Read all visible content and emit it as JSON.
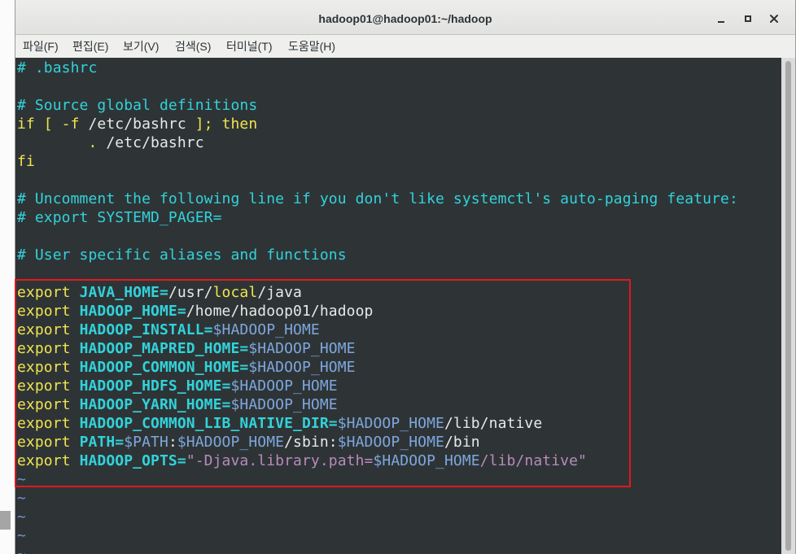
{
  "window": {
    "title": "hadoop01@hadoop01:~/hadoop",
    "controls": [
      "minimize-icon",
      "maximize-icon",
      "close-icon"
    ]
  },
  "menu": {
    "items": [
      "파일(F)",
      "편집(E)",
      "보기(V)",
      "검색(S)",
      "터미널(T)",
      "도움말(H)"
    ]
  },
  "terminal": {
    "background": "#2e3436",
    "lines": [
      [
        {
          "text": "# .bashrc",
          "color": "#32d2da"
        }
      ],
      [],
      [
        {
          "text": "# Source global definitions",
          "color": "#32d2da"
        }
      ],
      [
        {
          "text": "if [ -f ",
          "color": "#f1e44f"
        },
        {
          "text": "/etc/bashrc",
          "color": "#e9e9e7"
        },
        {
          "text": " ]; then",
          "color": "#f1e44f"
        }
      ],
      [
        {
          "text": "        . ",
          "color": "#f1e44f"
        },
        {
          "text": "/etc/bashrc",
          "color": "#e9e9e7"
        }
      ],
      [
        {
          "text": "fi",
          "color": "#f1e44f"
        }
      ],
      [],
      [
        {
          "text": "# Uncomment the following line if you don't like systemctl's auto-paging feature:",
          "color": "#32d2da"
        }
      ],
      [
        {
          "text": "# export SYSTEMD_PAGER=",
          "color": "#32d2da"
        }
      ],
      [],
      [
        {
          "text": "# User specific aliases and functions",
          "color": "#32d2da"
        }
      ],
      [],
      [
        {
          "text": "export ",
          "color": "#f1e44f"
        },
        {
          "text": "JAVA_HOME=",
          "color": "#32d2da",
          "bold": true
        },
        {
          "text": "/usr/",
          "color": "#e9e9e7"
        },
        {
          "text": "local",
          "color": "#f1e44f"
        },
        {
          "text": "/java",
          "color": "#e9e9e7"
        }
      ],
      [
        {
          "text": "export ",
          "color": "#f1e44f"
        },
        {
          "text": "HADOOP_HOME=",
          "color": "#32d2da",
          "bold": true
        },
        {
          "text": "/home/hadoop01/hadoop",
          "color": "#e9e9e7"
        }
      ],
      [
        {
          "text": "export ",
          "color": "#f1e44f"
        },
        {
          "text": "HADOOP_INSTALL=",
          "color": "#32d2da",
          "bold": true
        },
        {
          "text": "$HADOOP_HOME",
          "color": "#7ea7de"
        }
      ],
      [
        {
          "text": "export ",
          "color": "#f1e44f"
        },
        {
          "text": "HADOOP_MAPRED_HOME=",
          "color": "#32d2da",
          "bold": true
        },
        {
          "text": "$HADOOP_HOME",
          "color": "#7ea7de"
        }
      ],
      [
        {
          "text": "export ",
          "color": "#f1e44f"
        },
        {
          "text": "HADOOP_COMMON_HOME=",
          "color": "#32d2da",
          "bold": true
        },
        {
          "text": "$HADOOP_HOME",
          "color": "#7ea7de"
        }
      ],
      [
        {
          "text": "export ",
          "color": "#f1e44f"
        },
        {
          "text": "HADOOP_HDFS_HOME=",
          "color": "#32d2da",
          "bold": true
        },
        {
          "text": "$HADOOP_HOME",
          "color": "#7ea7de"
        }
      ],
      [
        {
          "text": "export ",
          "color": "#f1e44f"
        },
        {
          "text": "HADOOP_YARN_HOME=",
          "color": "#32d2da",
          "bold": true
        },
        {
          "text": "$HADOOP_HOME",
          "color": "#7ea7de"
        }
      ],
      [
        {
          "text": "export ",
          "color": "#f1e44f"
        },
        {
          "text": "HADOOP_COMMON_LIB_NATIVE_DIR=",
          "color": "#32d2da",
          "bold": true
        },
        {
          "text": "$HADOOP_HOME",
          "color": "#7ea7de"
        },
        {
          "text": "/lib/native",
          "color": "#e9e9e7"
        }
      ],
      [
        {
          "text": "export ",
          "color": "#f1e44f"
        },
        {
          "text": "PATH=",
          "color": "#32d2da",
          "bold": true
        },
        {
          "text": "$PATH",
          "color": "#7ea7de"
        },
        {
          "text": ":",
          "color": "#e9e9e7"
        },
        {
          "text": "$HADOOP_HOME",
          "color": "#7ea7de"
        },
        {
          "text": "/sbin:",
          "color": "#e9e9e7"
        },
        {
          "text": "$HADOOP_HOME",
          "color": "#7ea7de"
        },
        {
          "text": "/bin",
          "color": "#e9e9e7"
        }
      ],
      [
        {
          "text": "export ",
          "color": "#f1e44f"
        },
        {
          "text": "HADOOP_OPTS=",
          "color": "#32d2da",
          "bold": true
        },
        {
          "text": "\"-Djava.library.path=",
          "color": "#b98abd"
        },
        {
          "text": "$HADOOP_HOME",
          "color": "#7ea7de"
        },
        {
          "text": "/lib/native\"",
          "color": "#b98abd"
        }
      ],
      [
        {
          "text": "~",
          "color": "#7592cf"
        }
      ],
      [
        {
          "text": "~",
          "color": "#7592cf"
        }
      ],
      [
        {
          "text": "~",
          "color": "#7592cf"
        }
      ],
      [
        {
          "text": "~",
          "color": "#7592cf"
        }
      ],
      [
        {
          "text": "~",
          "color": "#7592cf"
        }
      ]
    ]
  },
  "annotation": {
    "border_color": "#e0191e"
  }
}
